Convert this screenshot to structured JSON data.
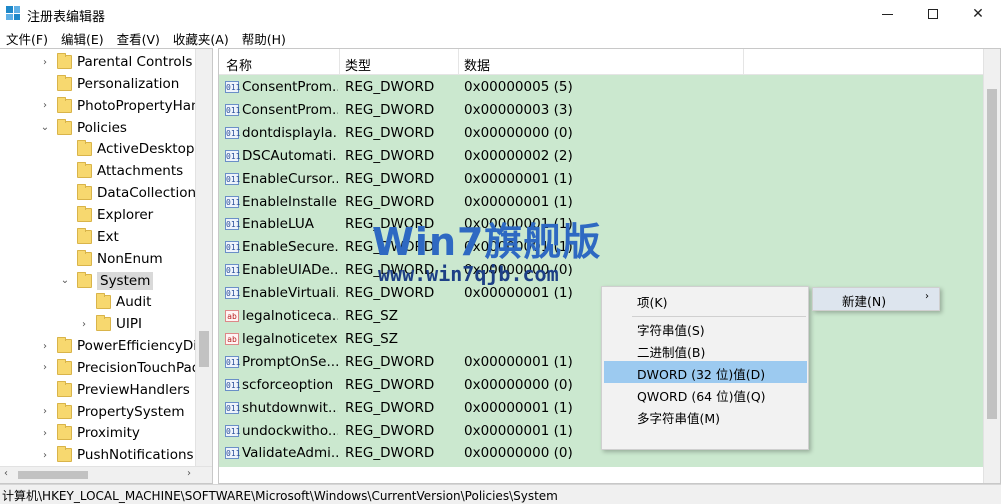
{
  "window": {
    "title": "注册表编辑器"
  },
  "menu": [
    "文件(F)",
    "编辑(E)",
    "查看(V)",
    "收藏夹(A)",
    "帮助(H)"
  ],
  "tree": [
    {
      "label": "Parental Controls",
      "toggle": "›",
      "level": 1
    },
    {
      "label": "Personalization",
      "toggle": "",
      "level": 1
    },
    {
      "label": "PhotoPropertyHan",
      "toggle": "›",
      "level": 1
    },
    {
      "label": "Policies",
      "toggle": "⌄",
      "level": 1
    },
    {
      "label": "ActiveDesktop",
      "toggle": "",
      "level": 2
    },
    {
      "label": "Attachments",
      "toggle": "",
      "level": 2
    },
    {
      "label": "DataCollection",
      "toggle": "",
      "level": 2
    },
    {
      "label": "Explorer",
      "toggle": "",
      "level": 2
    },
    {
      "label": "Ext",
      "toggle": "",
      "level": 2
    },
    {
      "label": "NonEnum",
      "toggle": "",
      "level": 2
    },
    {
      "label": "System",
      "toggle": "⌄",
      "level": 2,
      "selected": true
    },
    {
      "label": "Audit",
      "toggle": "",
      "level": 3
    },
    {
      "label": "UIPI",
      "toggle": "›",
      "level": 3
    },
    {
      "label": "PowerEfficiencyDia",
      "toggle": "›",
      "level": 1
    },
    {
      "label": "PrecisionTouchPad",
      "toggle": "›",
      "level": 1
    },
    {
      "label": "PreviewHandlers",
      "toggle": "",
      "level": 1
    },
    {
      "label": "PropertySystem",
      "toggle": "›",
      "level": 1
    },
    {
      "label": "Proximity",
      "toggle": "›",
      "level": 1
    },
    {
      "label": "PushNotifications",
      "toggle": "›",
      "level": 1
    }
  ],
  "columns": {
    "name": "名称",
    "type": "类型",
    "data": "数据"
  },
  "values": [
    {
      "name": "ConsentProm...",
      "type": "REG_DWORD",
      "data": "0x00000005 (5)",
      "icon": "dword"
    },
    {
      "name": "ConsentProm...",
      "type": "REG_DWORD",
      "data": "0x00000003 (3)",
      "icon": "dword"
    },
    {
      "name": "dontdisplayla...",
      "type": "REG_DWORD",
      "data": "0x00000000 (0)",
      "icon": "dword"
    },
    {
      "name": "DSCAutomati...",
      "type": "REG_DWORD",
      "data": "0x00000002 (2)",
      "icon": "dword"
    },
    {
      "name": "EnableCursor...",
      "type": "REG_DWORD",
      "data": "0x00000001 (1)",
      "icon": "dword"
    },
    {
      "name": "EnableInstalle...",
      "type": "REG_DWORD",
      "data": "0x00000001 (1)",
      "icon": "dword"
    },
    {
      "name": "EnableLUA",
      "type": "REG_DWORD",
      "data": "0x00000001 (1)",
      "icon": "dword"
    },
    {
      "name": "EnableSecure...",
      "type": "REG_DWORD",
      "data": "0x00000001 (1)",
      "icon": "dword"
    },
    {
      "name": "EnableUIADe...",
      "type": "REG_DWORD",
      "data": "0x00000000 (0)",
      "icon": "dword"
    },
    {
      "name": "EnableVirtuali...",
      "type": "REG_DWORD",
      "data": "0x00000001 (1)",
      "icon": "dword"
    },
    {
      "name": "legalnoticeca...",
      "type": "REG_SZ",
      "data": "",
      "icon": "sz"
    },
    {
      "name": "legalnoticetext",
      "type": "REG_SZ",
      "data": "",
      "icon": "sz"
    },
    {
      "name": "PromptOnSe...",
      "type": "REG_DWORD",
      "data": "0x00000001 (1)",
      "icon": "dword"
    },
    {
      "name": "scforceoption",
      "type": "REG_DWORD",
      "data": "0x00000000 (0)",
      "icon": "dword"
    },
    {
      "name": "shutdownwit...",
      "type": "REG_DWORD",
      "data": "0x00000001 (1)",
      "icon": "dword"
    },
    {
      "name": "undockwitho...",
      "type": "REG_DWORD",
      "data": "0x00000001 (1)",
      "icon": "dword"
    },
    {
      "name": "ValidateAdmi...",
      "type": "REG_DWORD",
      "data": "0x00000000 (0)",
      "icon": "dword"
    }
  ],
  "context_menu": {
    "new_label": "新建(N)",
    "items": [
      "项(K)",
      "字符串值(S)",
      "二进制值(B)",
      "DWORD (32 位)值(D)",
      "QWORD (64 位)值(Q)",
      "多字符串值(M)"
    ],
    "highlighted": "DWORD (32 位)值(D)"
  },
  "watermark": {
    "main": "Win7旗舰版",
    "url": "www.win7qjb.com"
  },
  "statusbar": {
    "path": "计算机\\HKEY_LOCAL_MACHINE\\SOFTWARE\\Microsoft\\Windows\\CurrentVersion\\Policies\\System"
  },
  "colors": {
    "row_bg": "#cbe8cf",
    "menu_highlight": "#9ccaf0",
    "watermark": "#2e69c2"
  }
}
